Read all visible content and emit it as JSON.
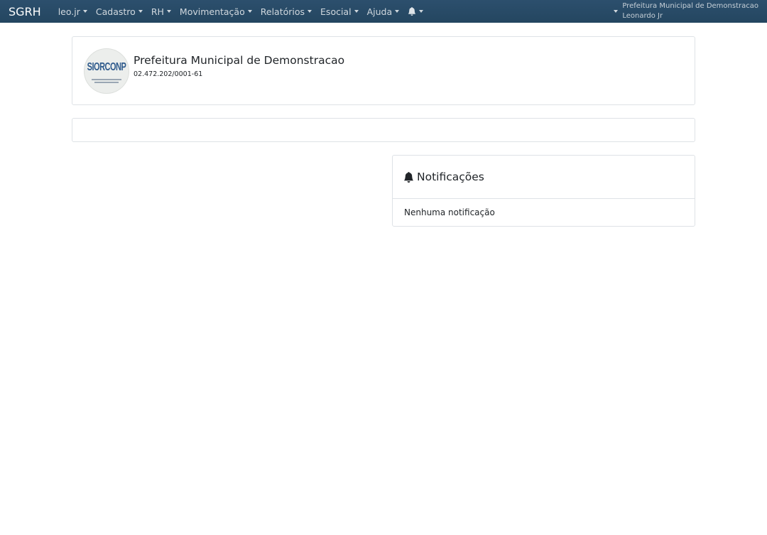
{
  "navbar": {
    "brand": "SGRH",
    "menu": [
      {
        "key": "user",
        "label": "leo.jr"
      },
      {
        "key": "cadastro",
        "label": "Cadastro"
      },
      {
        "key": "rh",
        "label": "RH"
      },
      {
        "key": "movimentacao",
        "label": "Movimentação"
      },
      {
        "key": "relatorios",
        "label": "Relatórios"
      },
      {
        "key": "esocial",
        "label": "Esocial"
      },
      {
        "key": "ajuda",
        "label": "Ajuda"
      }
    ],
    "bell_icon": "bell-icon",
    "account": {
      "organization": "Prefeitura Municipal de Demonstracao",
      "user": "Leonardo Jr"
    },
    "colors": {
      "background": "#2a4b68",
      "text": "#ffffff"
    }
  },
  "organization_card": {
    "logo_text": "SIORCONP",
    "name": "Prefeitura Municipal de Demonstracao",
    "cnpj": "02.472.202/0001-61"
  },
  "notifications": {
    "icon": "bell-icon",
    "title": "Notificações",
    "empty_message": "Nenhuma notificação"
  }
}
